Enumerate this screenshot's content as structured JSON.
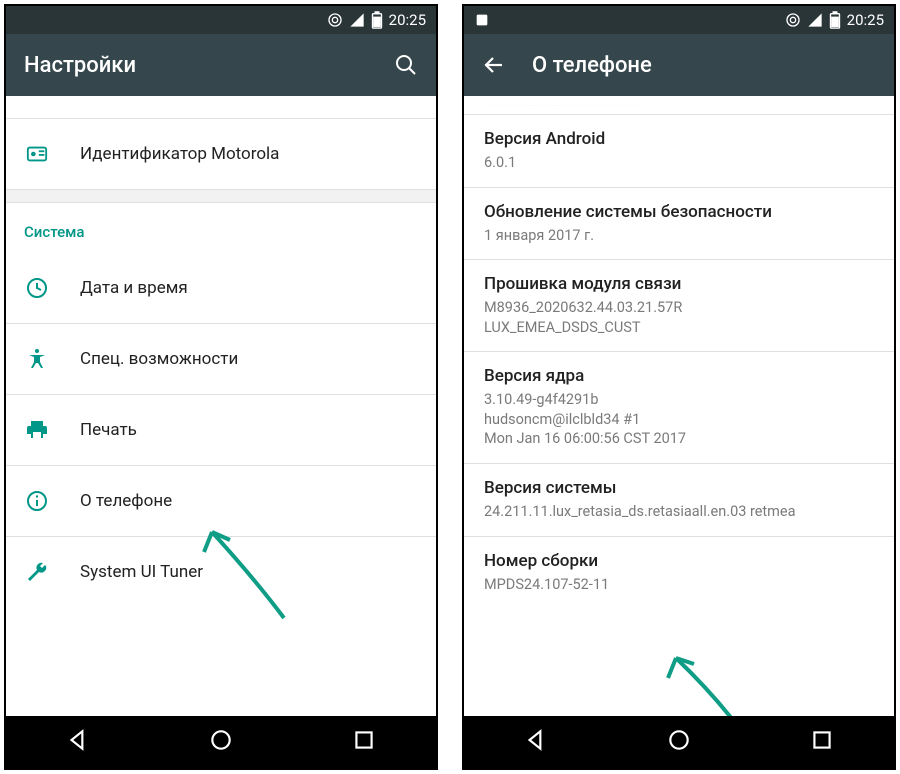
{
  "statusbar": {
    "time": "20:25"
  },
  "left": {
    "title": "Настройки",
    "topItem": "Идентификатор Motorola",
    "sectionHeader": "Система",
    "items": {
      "datetime": "Дата и время",
      "accessibility": "Спец. возможности",
      "print": "Печать",
      "about": "О телефоне",
      "tuner": "System UI Tuner"
    }
  },
  "right": {
    "title": "О телефоне",
    "items": {
      "android": {
        "title": "Версия Android",
        "sub": "6.0.1"
      },
      "security": {
        "title": "Обновление системы безопасности",
        "sub": "1 января 2017 г."
      },
      "baseband": {
        "title": "Прошивка модуля связи",
        "sub": "M8936_2020632.44.03.21.57R\nLUX_EMEA_DSDS_CUST"
      },
      "kernel": {
        "title": "Версия ядра",
        "sub": "3.10.49-g4f4291b\nhudsoncm@ilclbld34 #1\nMon Jan 16 06:00:56 CST 2017"
      },
      "system": {
        "title": "Версия системы",
        "sub": "24.211.11.lux_retasia_ds.retasiaall.en.03 retmea"
      },
      "build": {
        "title": "Номер сборки",
        "sub": "MPDS24.107-52-11"
      }
    }
  }
}
